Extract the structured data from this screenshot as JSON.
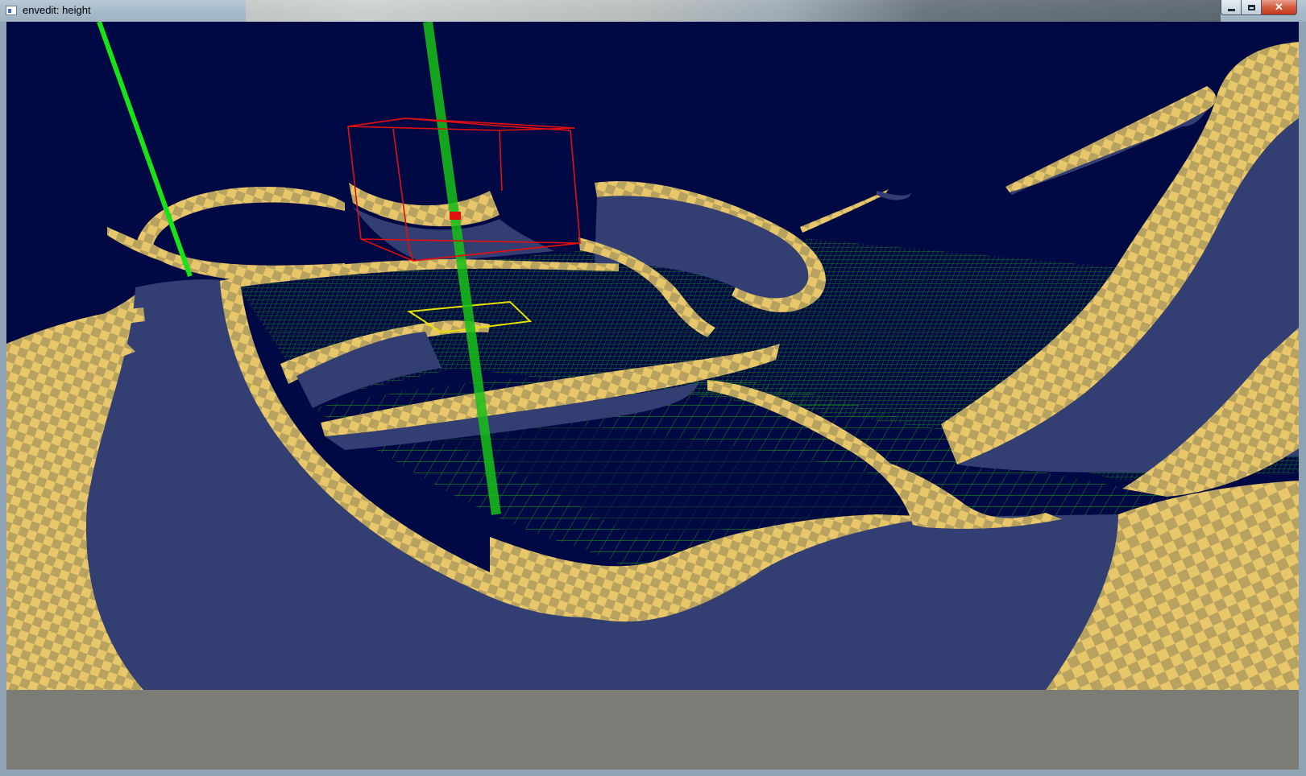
{
  "window": {
    "title": "envedit: height",
    "controls": {
      "minimize_icon": "minimize-icon",
      "maximize_icon": "maximize-icon",
      "close_icon": "close-icon"
    }
  },
  "viewport": {
    "description_icon": "3d-scene",
    "colors": {
      "sky": "#010944",
      "surface_fill": "#333f72",
      "checker_light": "#e8c66a",
      "checker_dark": "#b8a260",
      "grid_lines": "#1a8a1a",
      "axis_line": "#18e218",
      "selection_box": "#e01010",
      "selection_rect": "#e8e000",
      "status_panel": "#7c7c76"
    }
  }
}
